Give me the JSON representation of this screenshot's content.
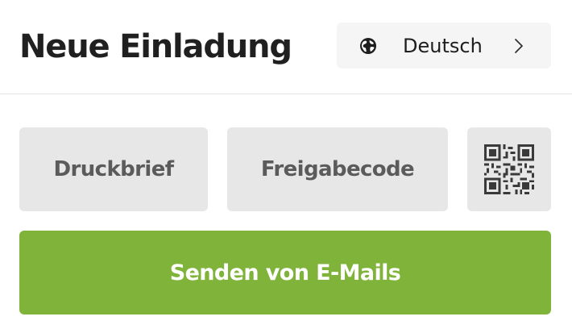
{
  "header": {
    "title": "Neue Einladung",
    "language": {
      "label": "Deutsch",
      "icon": "globe-icon",
      "chevron": "chevron-right-icon"
    }
  },
  "options": {
    "print_letter": "Druckbrief",
    "share_code": "Freigabecode",
    "qr_icon": "qr-code-icon"
  },
  "primary": {
    "send_email": "Senden von E-Mails"
  },
  "colors": {
    "primary": "#80b33a",
    "secondary_button": "#e7e7e7",
    "language_button": "#f5f5f5",
    "title_text": "#202020",
    "secondary_text": "#5b5b5b"
  }
}
